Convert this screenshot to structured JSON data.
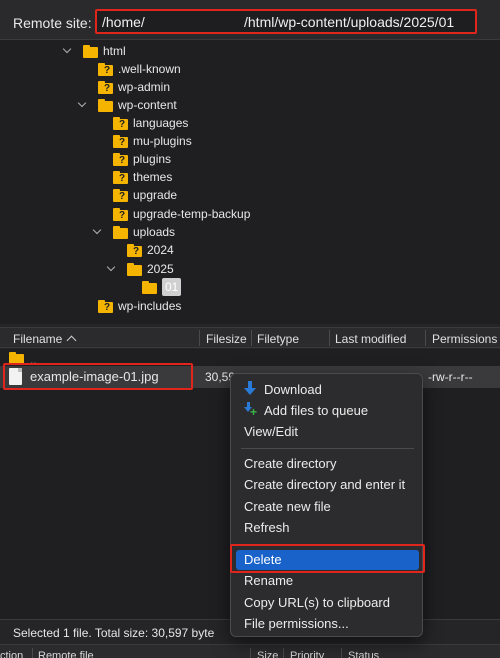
{
  "remote_site": {
    "label": "Remote site:",
    "path_start": "/home/",
    "path_end": "/html/wp-content/uploads/2025/01"
  },
  "tree": {
    "nodes": [
      {
        "label": "html",
        "expanded": true,
        "unknown": false
      },
      {
        "label": ".well-known",
        "expanded": false,
        "unknown": true
      },
      {
        "label": "wp-admin",
        "expanded": false,
        "unknown": true
      },
      {
        "label": "wp-content",
        "expanded": true,
        "unknown": false
      },
      {
        "label": "languages",
        "expanded": false,
        "unknown": true
      },
      {
        "label": "mu-plugins",
        "expanded": false,
        "unknown": true
      },
      {
        "label": "plugins",
        "expanded": false,
        "unknown": true
      },
      {
        "label": "themes",
        "expanded": false,
        "unknown": true
      },
      {
        "label": "upgrade",
        "expanded": false,
        "unknown": true
      },
      {
        "label": "upgrade-temp-backup",
        "expanded": false,
        "unknown": true
      },
      {
        "label": "uploads",
        "expanded": true,
        "unknown": false
      },
      {
        "label": "2024",
        "expanded": false,
        "unknown": true
      },
      {
        "label": "2025",
        "expanded": true,
        "unknown": false
      },
      {
        "label": "01",
        "expanded": false,
        "unknown": false,
        "selected": true
      },
      {
        "label": "wp-includes",
        "expanded": false,
        "unknown": true
      }
    ]
  },
  "file_list": {
    "columns": [
      "Filename",
      "Filesize",
      "Filetype",
      "Last modified",
      "Permissions"
    ],
    "rows": [
      {
        "name": "..",
        "size": "",
        "type": "",
        "modified": "",
        "permissions": ""
      },
      {
        "name": "example-image-01.jpg",
        "size": "30,59",
        "type": "",
        "modified": "",
        "permissions": "-rw-r--r--"
      }
    ]
  },
  "context_menu": {
    "items": [
      {
        "label": "Download",
        "icon": "download-icon"
      },
      {
        "label": "Add files to queue",
        "icon": "add-queue-icon"
      },
      {
        "label": "View/Edit"
      },
      {
        "label": "Create directory"
      },
      {
        "label": "Create directory and enter it"
      },
      {
        "label": "Create new file"
      },
      {
        "label": "Refresh"
      },
      {
        "label": "Delete",
        "highlighted": true
      },
      {
        "label": "Rename"
      },
      {
        "label": "Copy URL(s) to clipboard"
      },
      {
        "label": "File permissions..."
      }
    ]
  },
  "status": {
    "text": "Selected 1 file. Total size: 30,597 byte"
  },
  "queue": {
    "columns": [
      "ction",
      "Remote file",
      "Size",
      "Priority",
      "Status"
    ]
  },
  "colors": {
    "highlight_box": "#e0261c",
    "menu_selection": "#1862c9",
    "folder": "#f5b400"
  }
}
